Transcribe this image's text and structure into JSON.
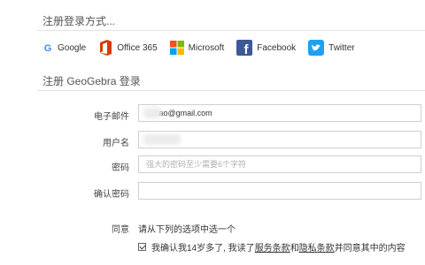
{
  "oauth": {
    "title": "注册登录方式...",
    "providers": [
      {
        "label": "Google",
        "icon": "google-icon",
        "color": "#4285F4"
      },
      {
        "label": "Office 365",
        "icon": "office365-icon",
        "color": "#D83B01"
      },
      {
        "label": "Microsoft",
        "icon": "microsoft-icon",
        "color": "#00A4EF"
      },
      {
        "label": "Facebook",
        "icon": "facebook-icon",
        "color": "#3B5998"
      },
      {
        "label": "Twitter",
        "icon": "twitter-icon",
        "color": "#1DA1F2"
      }
    ]
  },
  "register": {
    "title": "注册 GeoGebra 登录",
    "fields": {
      "email": {
        "label": "电子邮件",
        "value": "...ztao@gmail.com"
      },
      "username": {
        "label": "用户名",
        "value": ""
      },
      "password": {
        "label": "密码",
        "placeholder": "强大的密码至少需要6个字符"
      },
      "confirm": {
        "label": "确认密码",
        "placeholder": ""
      }
    },
    "agree": {
      "label": "同意",
      "hint": "请从下列的选项中选一个",
      "check_prefix": "我确认我14岁多了, 我读了",
      "terms_link": "服务条款",
      "and": "和",
      "privacy_link": "隐私条款",
      "check_suffix": "并同意其中的内容",
      "checked": true
    }
  }
}
